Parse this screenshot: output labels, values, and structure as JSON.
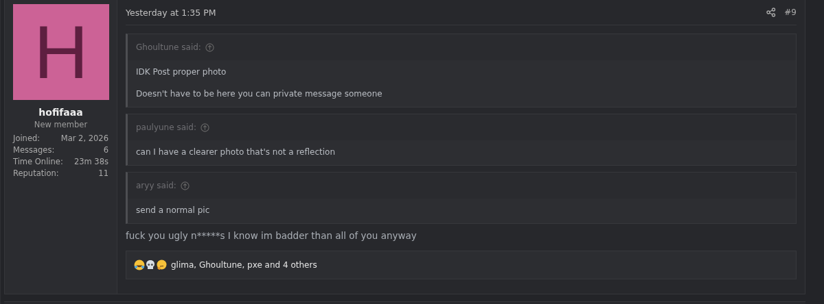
{
  "post": {
    "author": {
      "avatar_letter": "H",
      "name": "hofifaaa",
      "title": "New member",
      "stats": [
        {
          "label": "Joined:",
          "value": "Mar 2, 2026"
        },
        {
          "label": "Messages:",
          "value": "6"
        },
        {
          "label": "Time Online:",
          "value": "23m 38s"
        },
        {
          "label": "Reputation:",
          "value": "11"
        }
      ]
    },
    "date": "Yesterday at 1:35 PM",
    "number": "#9",
    "quotes": [
      {
        "author": "Ghoultune said:",
        "paragraphs": [
          "IDK Post proper photo",
          "Doesn't have to be here you can private message someone"
        ]
      },
      {
        "author": "paulyune said:",
        "paragraphs": [
          "can I have a clearer photo that's not a reflection"
        ]
      },
      {
        "author": "aryy said:",
        "paragraphs": [
          "send a normal pic"
        ]
      }
    ],
    "message": "fuck you ugly n*****s I know im badder than all of you anyway",
    "reactions": {
      "emojis": [
        {
          "kind": "laughing"
        },
        {
          "kind": "skull"
        },
        {
          "kind": "thinking"
        }
      ],
      "text": "glima, Ghoultune, pxe and 4 others"
    }
  }
}
